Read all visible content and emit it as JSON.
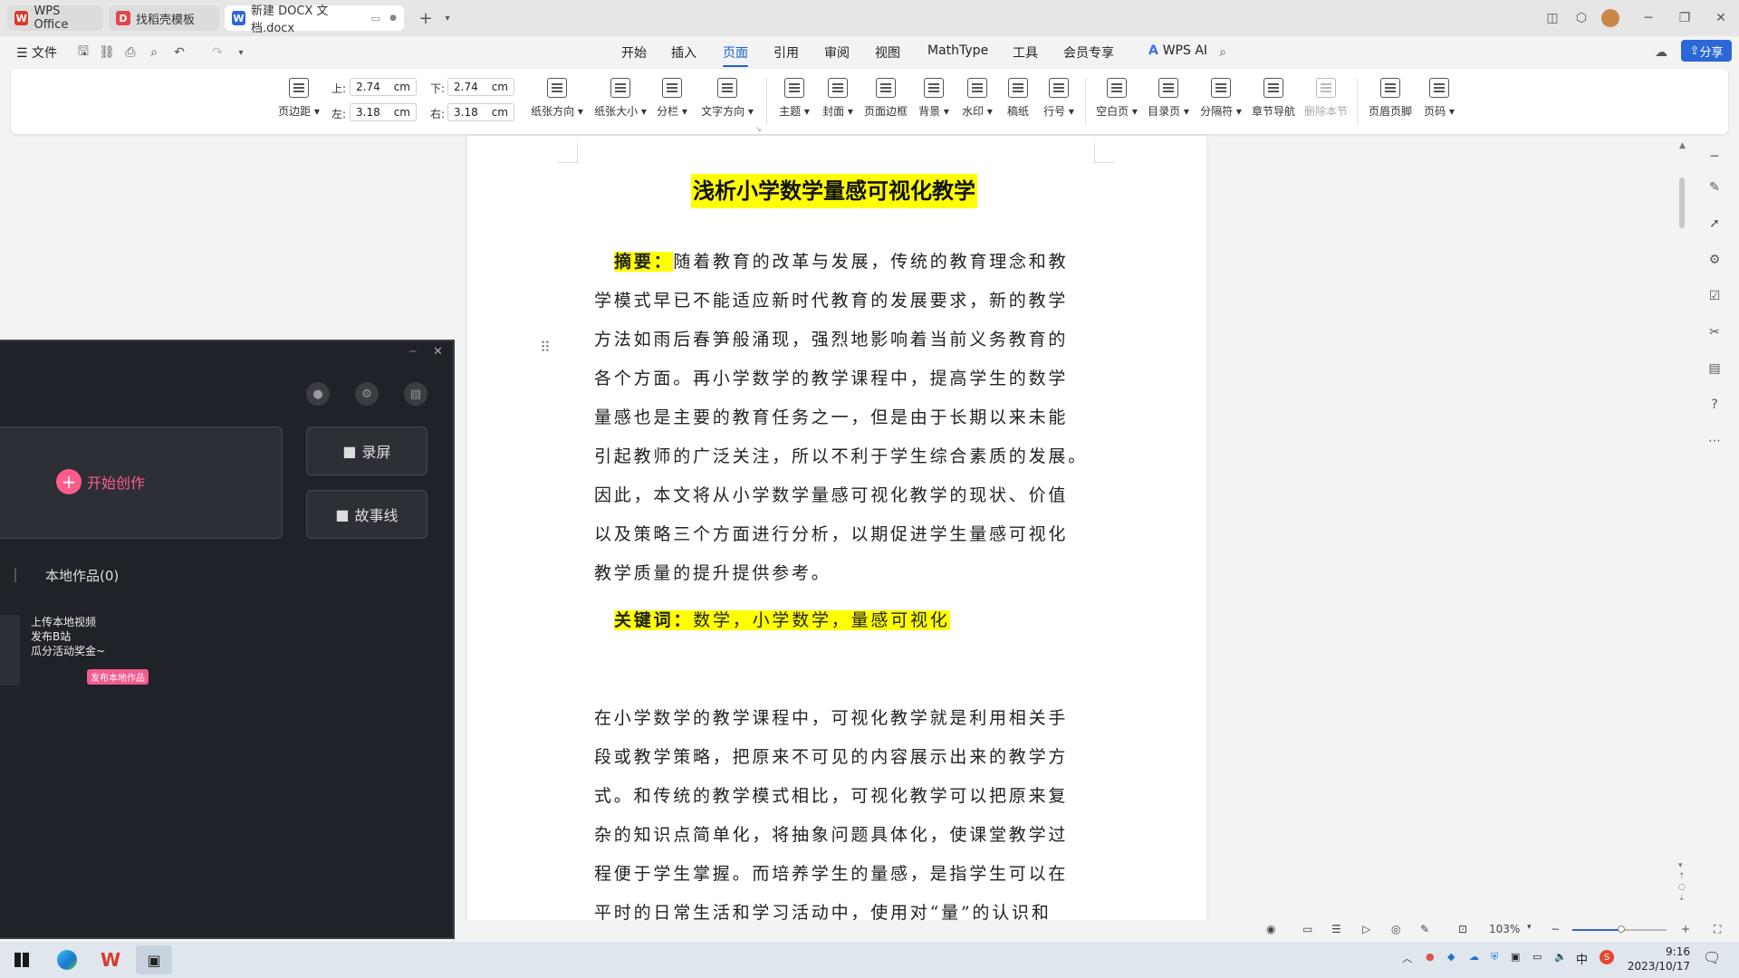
{
  "tabs": [
    {
      "label": "WPS Office",
      "icon": "wps-logo-icon"
    },
    {
      "label": "找稻壳模板",
      "icon": "docer-icon"
    },
    {
      "label": "新建 DOCX 文档.docx",
      "icon": "word-doc-icon"
    }
  ],
  "menu": {
    "file": "文件",
    "items": [
      "开始",
      "插入",
      "页面",
      "引用",
      "审阅",
      "视图",
      "MathType",
      "工具",
      "会员专享"
    ],
    "active": "页面",
    "wps_ai": "WPS AI",
    "share": "分享"
  },
  "ribbon": {
    "margins_label": "页边距",
    "top_label": "上:",
    "top_value": "2.74",
    "bottom_label": "下:",
    "bottom_value": "2.74",
    "left_label": "左:",
    "left_value": "3.18",
    "right_label": "右:",
    "right_value": "3.18",
    "unit": "cm",
    "buttons": [
      "纸张方向",
      "纸张大小",
      "分栏",
      "文字方向",
      "主题",
      "封面",
      "页面边框",
      "背景",
      "水印",
      "稿纸",
      "行号",
      "空白页",
      "目录页",
      "分隔符",
      "章节导航",
      "删除本节",
      "页眉页脚",
      "页码"
    ]
  },
  "document": {
    "title": "浅析小学数学量感可视化教学",
    "abstract_label": "摘要：",
    "abstract_lines": [
      "随着教育的改革与发展，传统的教育理念和教",
      "学模式早已不能适应新时代教育的发展要求，新的教学",
      "方法如雨后春笋般涌现，强烈地影响着当前义务教育的",
      "各个方面。再小学数学的教学课程中，提高学生的数学",
      "量感也是主要的教育任务之一，但是由于长期以来未能",
      "引起教师的广泛关注，所以不利于学生综合素质的发展。",
      "因此，本文将从小学数学量感可视化教学的现状、价值",
      "以及策略三个方面进行分析，以期促进学生量感可视化",
      "教学质量的提升提供参考。"
    ],
    "keywords_label": "关键词：",
    "keywords": "数学，小学数学，量感可视化",
    "body_lines": [
      "在小学数学的教学课程中，可视化教学就是利用相关手",
      "段或教学策略，把原来不可见的内容展示出来的教学方",
      "式。和传统的教学模式相比，可视化教学可以把原来复",
      "杂的知识点简单化，将抽象问题具体化，使课堂教学过",
      "程便于学生掌握。而培养学生的量感，是指学生可以在",
      "平时的日常生活和学习活动中，使用对“量”的认识和"
    ]
  },
  "panel": {
    "start_create": "开始创作",
    "record": "录屏",
    "storyline": "故事线",
    "local_works": "本地作品(0)",
    "promo_lines": [
      "上传本地视频",
      "发布B站",
      "瓜分活动奖金~"
    ],
    "promo_button": "发布本地作品"
  },
  "status": {
    "zoom": "103%"
  },
  "taskbar": {
    "time": "9:16",
    "date": "2023/10/17",
    "ime": "中"
  }
}
